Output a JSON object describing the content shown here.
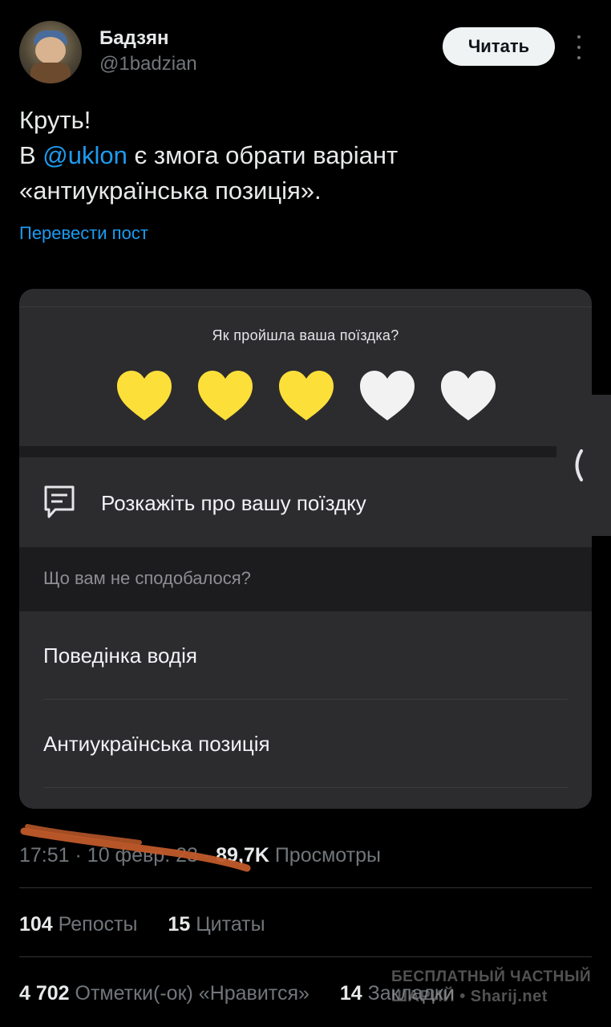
{
  "author": {
    "name": "Бадзян",
    "handle": "@1badzian"
  },
  "follow_label": "Читать",
  "tweet": {
    "line1": "Круть!",
    "line2_prefix": "В ",
    "mention": "@uklon",
    "line2_suffix": " є змога обрати варіант",
    "line3": "«антиукраїнська позиція».",
    "translate_label": "Перевести пост"
  },
  "card": {
    "rating_question": "Як пройшла ваша поїздка?",
    "rating": 3,
    "rating_max": 5,
    "heart_colors": {
      "filled": "#fddf3a",
      "empty": "#f2f2f2"
    },
    "feedback_label": "Розкажіть про вашу поїздку",
    "section_label": "Що вам не сподобалося?",
    "options": [
      "Поведінка водія",
      "Антиукраїнська позиція"
    ]
  },
  "meta": {
    "time": "17:51",
    "date": "10 февр. 23",
    "views_count": "89,7K",
    "views_label": "Просмотры"
  },
  "stats": {
    "reposts_count": "104",
    "reposts_label": "Репосты",
    "quotes_count": "15",
    "quotes_label": "Цитаты",
    "likes_count": "4 702",
    "likes_label": "Отметки(-ок) «Нравится»",
    "bookmarks_count": "14",
    "bookmarks_label": "Закладки"
  },
  "watermark": {
    "line1": "БЕСПЛАТНЫЙ ЧАСТНЫЙ",
    "line2": "ШАРИЙ • Sharij.net"
  },
  "colors": {
    "accent": "#1d9bf0",
    "annotation": "#c05a2a"
  }
}
